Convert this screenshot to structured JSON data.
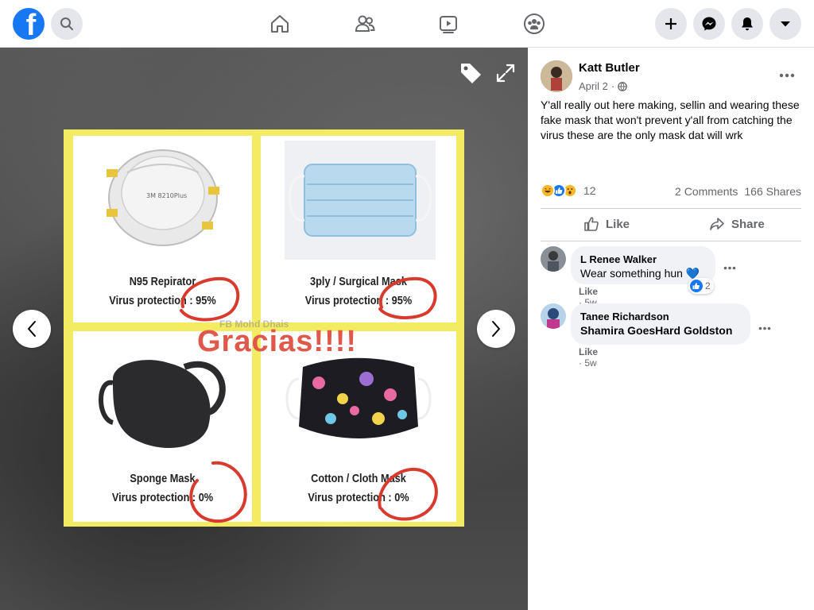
{
  "topbar": {
    "logo_letter": "f",
    "icons": [
      "facebook-logo",
      "search-icon",
      "home-icon",
      "friends-icon",
      "watch-icon",
      "groups-icon",
      "plus-icon",
      "messenger-icon",
      "notifications-icon",
      "account-menu-icon"
    ]
  },
  "viewer": {
    "image": {
      "cells": [
        {
          "name": "N95 Repirator",
          "protection": "Virus protection : 95%"
        },
        {
          "name": "3ply / Surgical Mask",
          "protection": "Virus protection : 95%"
        },
        {
          "name": "Sponge Mask",
          "protection": "Virus protection : 0%"
        },
        {
          "name": "Cotton / Cloth Mask",
          "protection": "Virus protection : 0%"
        }
      ],
      "overlay_text": "Gracias!!!!",
      "watermark": "FB Mohd Dhais"
    },
    "icons": [
      "tag-icon",
      "expand-icon",
      "previous-arrow-icon",
      "next-arrow-icon"
    ]
  },
  "post": {
    "author": "Katt Butler",
    "date": "April 2",
    "date_separator": "·",
    "body": "Y'all really out here making, sellin and wearing these fake mask that won't prevent y'all from catching the virus these are the only mask dat will wrk",
    "reaction_count": "12",
    "comments_count": "2 Comments",
    "shares_count": "166 Shares",
    "like_label": "Like",
    "share_label": "Share"
  },
  "comments": [
    {
      "author": "L Renee Walker",
      "text": "Wear something hun",
      "emoji": "💙",
      "reaction_count": "2",
      "like_label": "Like",
      "time": "5w",
      "separator": "·"
    },
    {
      "author": "Tanee Richardson",
      "text": "Shamira GoesHard Goldston",
      "like_label": "Like",
      "time": "5w",
      "separator": "·"
    }
  ],
  "colors": {
    "brand": "#1877f2",
    "secondary_text": "#65676b",
    "bubble": "#f0f2f5",
    "photo_border": "#f3ec63",
    "annotation_red": "#d93a2e",
    "gracias": "#e0584a"
  }
}
